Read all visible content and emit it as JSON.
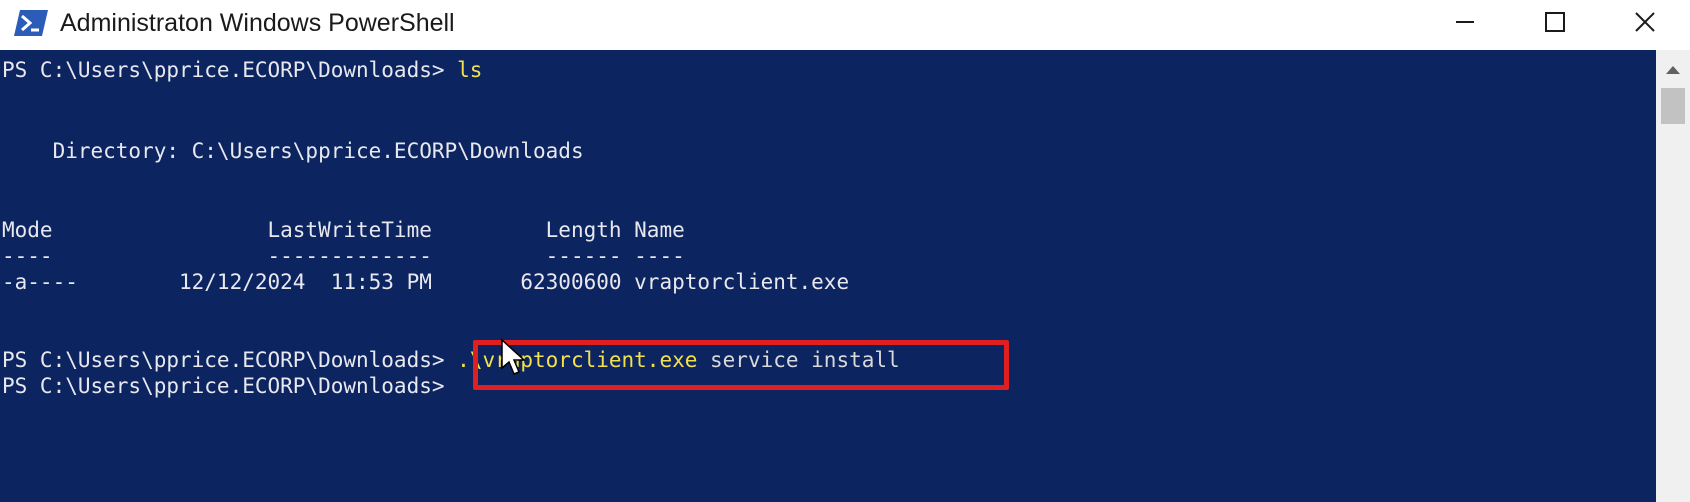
{
  "window": {
    "title": "Administraton Windows PowerShell"
  },
  "console": {
    "lines": [
      {
        "prompt": "PS C:\\Users\\pprice.ECORP\\Downloads> ",
        "command": "ls"
      },
      {
        "text": "    Directory: C:\\Users\\pprice.ECORP\\Downloads"
      },
      {
        "text": "Mode                 LastWriteTime         Length Name"
      },
      {
        "text": "----                 -------------         ------ ----"
      },
      {
        "text": "-a----        12/12/2024  11:53 PM       62300600 vraptorclient.exe"
      },
      {
        "prompt": "PS C:\\Users\\pprice.ECORP\\Downloads> ",
        "command": ".\\vraptorclient.exe",
        "args": " service install"
      },
      {
        "prompt": "PS C:\\Users\\pprice.ECORP\\Downloads> "
      }
    ]
  },
  "colors": {
    "console_bg": "#0c2460",
    "console_fg": "#e8e8ee",
    "command": "#f4e14a",
    "highlight": "#e02020"
  },
  "icons": {
    "app": "powershell-icon",
    "minimize": "minimize-icon",
    "maximize": "maximize-icon",
    "close": "close-icon"
  }
}
